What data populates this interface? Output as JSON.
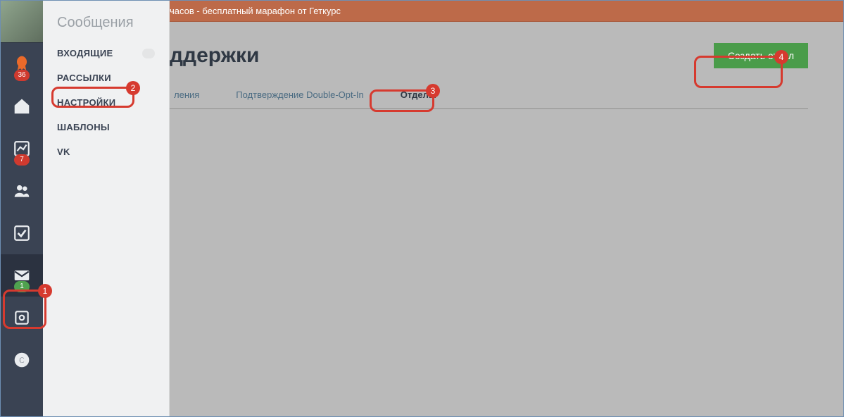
{
  "banner_text": "часов - бесплатный марафон от Геткурс",
  "rail": {
    "badges": {
      "rocket": "36",
      "chart": "7",
      "mail": "1"
    }
  },
  "flyout": {
    "title": "Сообщения",
    "items": [
      "ВХОДЯЩИЕ",
      "РАССЫЛКИ",
      "НАСТРОЙКИ",
      "ШАБЛОНЫ",
      "VK"
    ],
    "inbox_badge": "-"
  },
  "main": {
    "page_title_fragment": "ддержки",
    "tabs": [
      "ления",
      "Подтверждение Double-Opt-In",
      "Отделы"
    ],
    "active_tab_index": 2,
    "create_button": "Создать отдел"
  },
  "annotations": {
    "1": "1",
    "2": "2",
    "3": "3",
    "4": "4"
  }
}
